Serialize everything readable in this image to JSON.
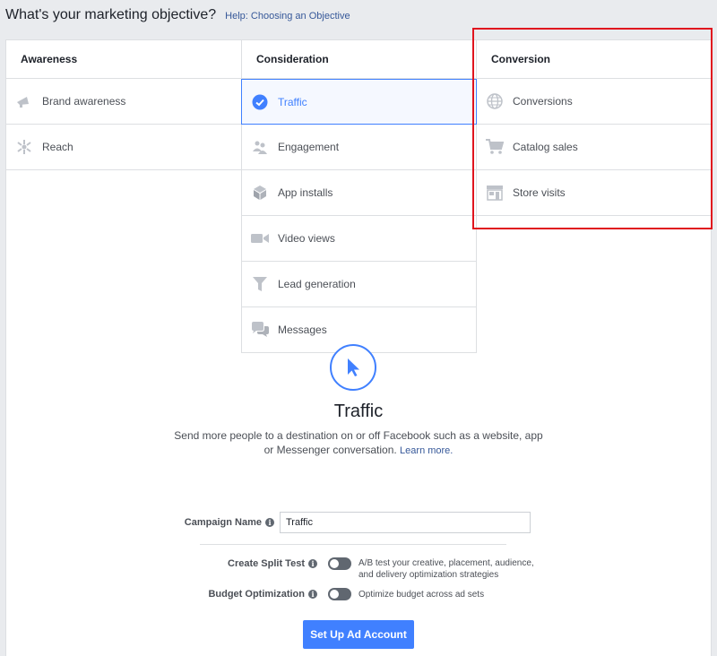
{
  "header": {
    "title": "What's your marketing objective?",
    "help_link": "Help: Choosing an Objective"
  },
  "columns": [
    {
      "heading": "Awareness",
      "items": [
        {
          "label": "Brand awareness",
          "icon": "megaphone-icon"
        },
        {
          "label": "Reach",
          "icon": "reach-icon"
        }
      ]
    },
    {
      "heading": "Consideration",
      "items": [
        {
          "label": "Traffic",
          "icon": "check-circle-icon",
          "selected": true
        },
        {
          "label": "Engagement",
          "icon": "people-icon"
        },
        {
          "label": "App installs",
          "icon": "box-icon"
        },
        {
          "label": "Video views",
          "icon": "video-camera-icon"
        },
        {
          "label": "Lead generation",
          "icon": "funnel-icon"
        },
        {
          "label": "Messages",
          "icon": "chat-bubbles-icon"
        }
      ]
    },
    {
      "heading": "Conversion",
      "items": [
        {
          "label": "Conversions",
          "icon": "globe-icon"
        },
        {
          "label": "Catalog sales",
          "icon": "cart-icon"
        },
        {
          "label": "Store visits",
          "icon": "store-icon"
        }
      ]
    }
  ],
  "detail": {
    "icon": "cursor-icon",
    "title": "Traffic",
    "description": "Send more people to a destination on or off Facebook such as a website, app or Messenger conversation.",
    "learn_more": "Learn more."
  },
  "form": {
    "campaign_name_label": "Campaign Name",
    "campaign_name_value": "Traffic",
    "split_test_label": "Create Split Test",
    "split_test_text": "A/B test your creative, placement, audience, and delivery optimization strategies",
    "budget_label": "Budget Optimization",
    "budget_text": "Optimize budget across ad sets",
    "cta_label": "Set Up Ad Account"
  },
  "colors": {
    "accent": "#4080ff",
    "highlight_box": "#e0141e",
    "icon_gray": "#90949c"
  }
}
